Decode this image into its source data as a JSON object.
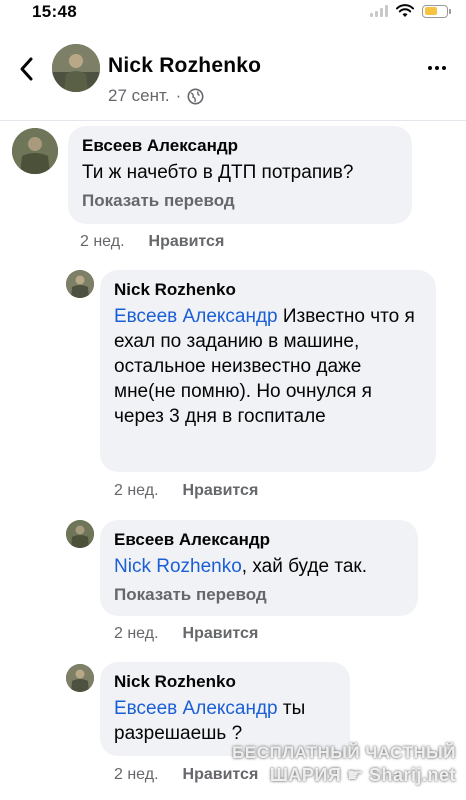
{
  "status_bar": {
    "time": "15:48"
  },
  "header": {
    "name": "Nick Rozhenko",
    "date": "27 сент.",
    "separator": "·"
  },
  "comments": [
    {
      "author": "Евсеев Александр",
      "mention": "",
      "text": "Ти ж начебто в ДТП потрапив?",
      "translate": "Показать перевод",
      "time": "2 нед.",
      "like": "Нравится"
    },
    {
      "author": "Nick Rozhenko",
      "mention": "Евсеев Александр",
      "text": " Известно что я ехал по заданию в машине, остальное неизвестно даже мне(не помню). Но очнулся я через 3 дня в госпитале",
      "translate": "",
      "time": "2 нед.",
      "like": "Нравится"
    },
    {
      "author": "Евсеев Александр",
      "mention": "Nick Rozhenko",
      "text": ", хай буде так.",
      "translate": "Показать перевод",
      "time": "2 нед.",
      "like": "Нравится"
    },
    {
      "author": "Nick Rozhenko",
      "mention": "Евсеев Александр",
      "text": " ты разрешаешь ?",
      "translate": "",
      "time": "2 нед.",
      "like": "Нравится"
    }
  ],
  "watermark": {
    "line1": "БЕСПЛАТНЫЙ ЧАСТНЫЙ",
    "line2": "ШАРИЯ",
    "line3": "Sharij.net"
  },
  "colors": {
    "mention": "#1b5fd6",
    "bubble": "#f0f2f5",
    "meta": "#65676b"
  }
}
